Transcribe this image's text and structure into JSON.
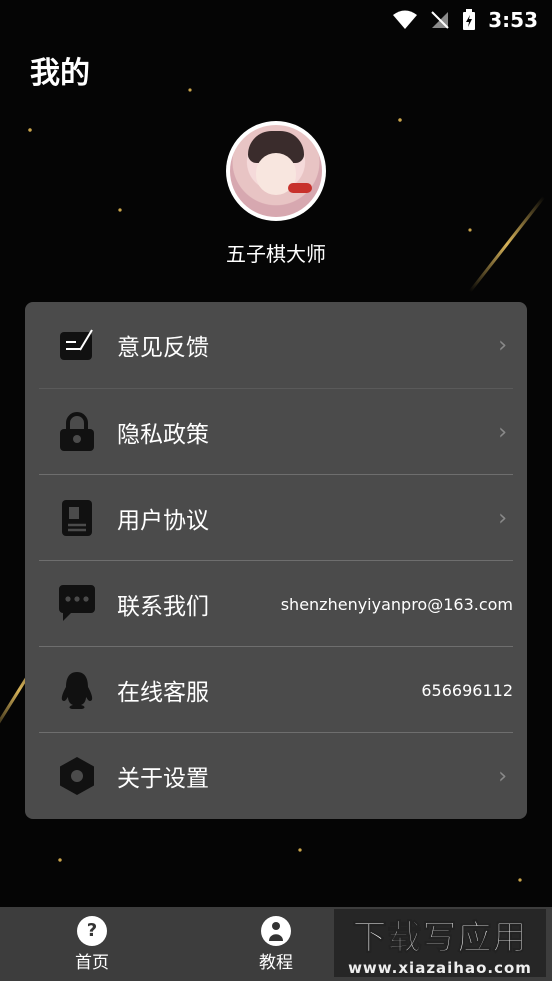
{
  "status": {
    "time": "3:53"
  },
  "header": {
    "title": "我的"
  },
  "profile": {
    "name": "五子棋大师"
  },
  "menu": [
    {
      "label": "意见反馈",
      "icon": "edit-note-icon",
      "value": ""
    },
    {
      "label": "隐私政策",
      "icon": "lock-icon",
      "value": ""
    },
    {
      "label": "用户协议",
      "icon": "document-icon",
      "value": ""
    },
    {
      "label": "联系我们",
      "icon": "chat-bubble-icon",
      "value": "shenzhenyiyanpro@163.com"
    },
    {
      "label": "在线客服",
      "icon": "qq-penguin-icon",
      "value": "656696112"
    },
    {
      "label": "关于设置",
      "icon": "hexagon-settings-icon",
      "value": ""
    }
  ],
  "tabbar": {
    "items": [
      {
        "label": "首页",
        "icon": "question-circle-icon"
      },
      {
        "label": "教程",
        "icon": "person-circle-icon"
      }
    ]
  },
  "watermark": {
    "main": "下载写应用",
    "sub": "www.xiazaihao.com"
  },
  "colors": {
    "card": "#4b4b4b",
    "gold": "#c9a44b",
    "tabbar": "#3d3d3d"
  }
}
